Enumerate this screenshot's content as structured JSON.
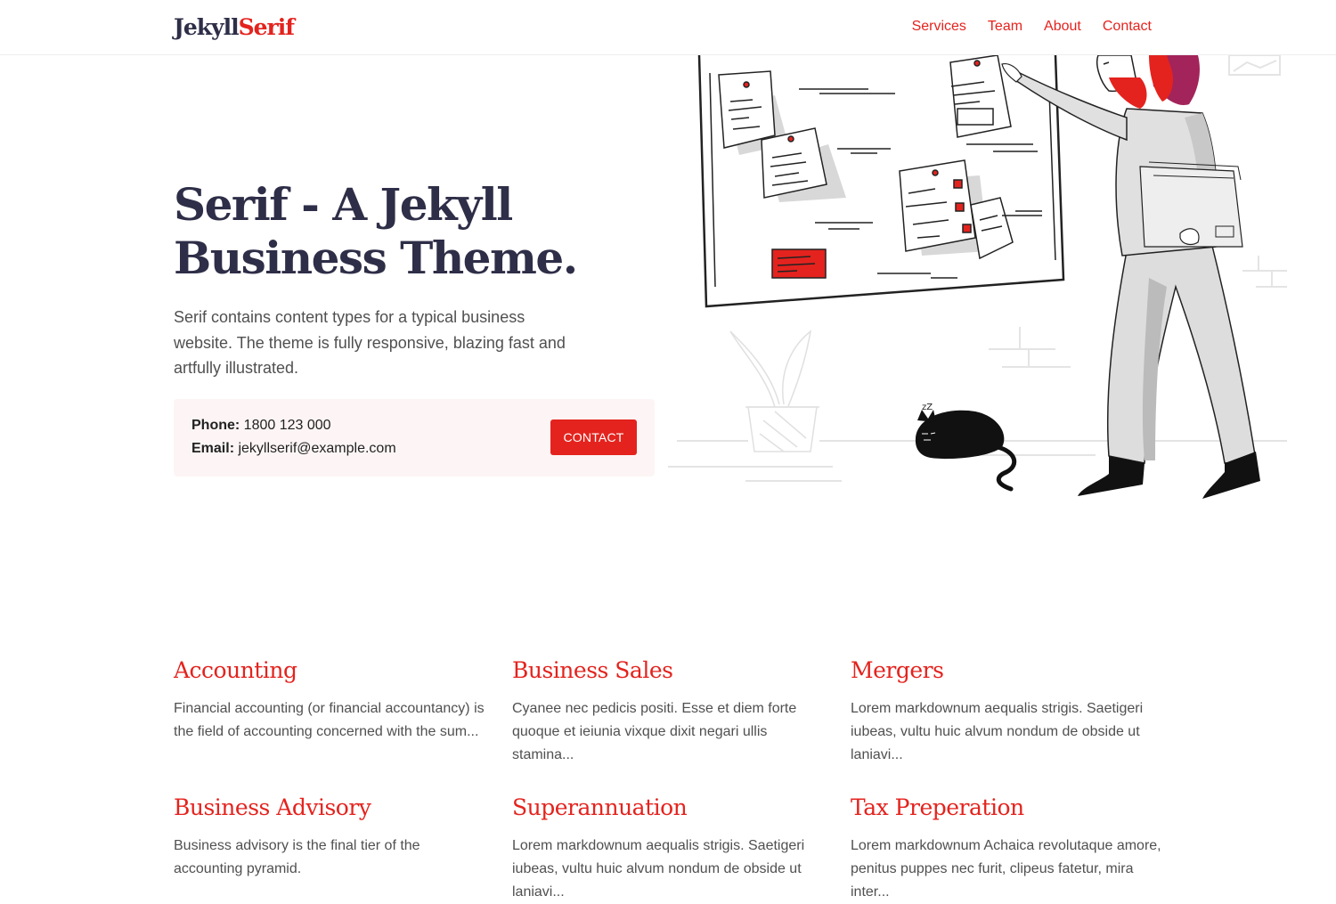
{
  "header": {
    "logo_part1": "Jekyll",
    "logo_part2": "Serif",
    "nav": [
      {
        "label": "Services"
      },
      {
        "label": "Team"
      },
      {
        "label": "About"
      },
      {
        "label": "Contact"
      }
    ]
  },
  "hero": {
    "title_line1": "Serif - A Jekyll",
    "title_line2": "Business Theme.",
    "description": "Serif contains content types for a typical business website. The theme is fully responsive, blazing fast and artfully illustrated.",
    "phone_label": "Phone:",
    "phone_value": "1800 123 000",
    "email_label": "Email:",
    "email_value": "jekyllserif@example.com",
    "contact_button": "Contact"
  },
  "services": [
    {
      "title": "Accounting",
      "summary": "Financial accounting (or financial accountancy) is the field of accounting concerned with the sum..."
    },
    {
      "title": "Business Sales",
      "summary": "Cyanee nec pedicis positi. Esse et diem forte quoque et ieiunia vixque dixit negari ullis stamina..."
    },
    {
      "title": "Mergers",
      "summary": "Lorem markdownum aequalis strigis. Saetigeri iubeas, vultu huic alvum nondum de obside ut laniavi..."
    },
    {
      "title": "Business Advisory",
      "summary": "Business advisory is the final tier of the accounting pyramid."
    },
    {
      "title": "Superannuation",
      "summary": "Lorem markdownum aequalis strigis. Saetigeri iubeas, vultu huic alvum nondum de obside ut laniavi..."
    },
    {
      "title": "Tax Preperation",
      "summary": "Lorem markdownum Achaica revolutaque amore, penitus puppes nec furit, clipeus fatetur, mira inter..."
    }
  ],
  "illustration": {
    "cat_sleep_text": "zZ"
  },
  "colors": {
    "accent": "#e4231e",
    "heading": "#2e2e48",
    "body_text": "#505050",
    "contact_box_bg": "#fdf5f5"
  },
  "icons": [
    "hero-illustration"
  ]
}
